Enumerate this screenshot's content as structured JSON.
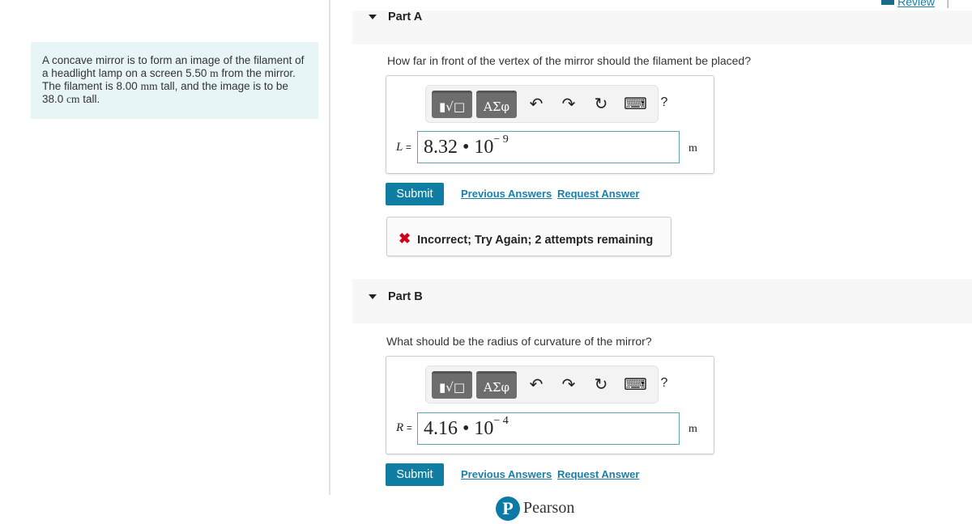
{
  "header": {
    "review_label": "Review",
    "separator": "|"
  },
  "problem": {
    "text_html_parts": [
      "A concave mirror is to form an image of the filament of a headlight lamp on a screen 5.50 ",
      "m",
      " from the mirror. The filament is 8.00 ",
      "mm",
      " tall, and the image is to be 38.0 ",
      "cm",
      " tall."
    ]
  },
  "parts": [
    {
      "label": "Part A",
      "question": "How far in front of the vertex of the mirror should the filament be placed?",
      "variable": "L",
      "equals": "=",
      "mantissa": "8.32 • 10",
      "exponent": "− 9",
      "unit": "m",
      "submit": "Submit",
      "previous": "Previous Answers",
      "request": "Request Answer",
      "feedback": "Incorrect; Try Again; 2 attempts remaining"
    },
    {
      "label": "Part B",
      "question": "What should be the radius of curvature of the mirror?",
      "variable": "R",
      "equals": "=",
      "mantissa": "4.16 • 10",
      "exponent": "− 4",
      "unit": "m",
      "submit": "Submit",
      "previous": "Previous Answers",
      "request": "Request Answer"
    }
  ],
  "toolbar": {
    "templates": "▮√□",
    "greek": "ΑΣφ",
    "undo": "↶",
    "redo": "↷",
    "reset": "↻",
    "keyboard": "⌨",
    "help": "?"
  },
  "footer": {
    "logo_letter": "P",
    "brand": "Pearson"
  },
  "colors": {
    "accent": "#107ea3",
    "error": "#d0021b",
    "problem_bg": "#e8f5f6"
  }
}
